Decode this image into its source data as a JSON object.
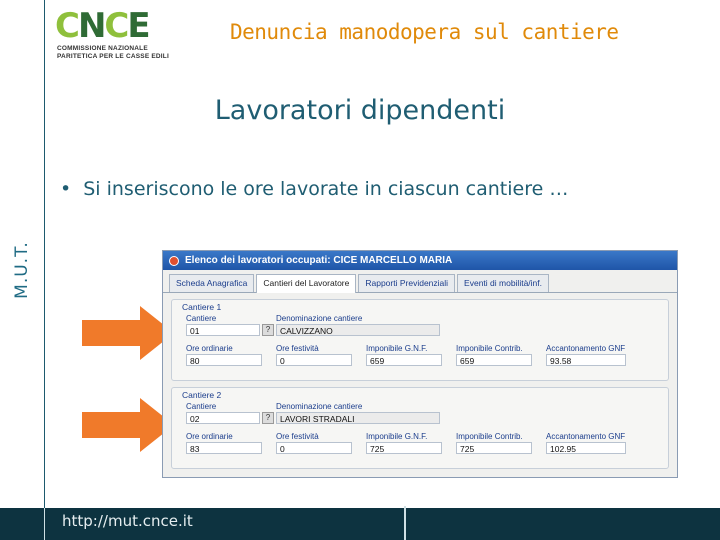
{
  "side_label": "M.U.T.",
  "logo": {
    "text_main": "CNCE",
    "sub1": "COMMISSIONE NAZIONALE",
    "sub2": "PARITETICA PER LE CASSE EDILI"
  },
  "header_title": "Denuncia manodopera sul cantiere",
  "page_title": "Lavoratori dipendenti",
  "bullet": "Si inseriscono le ore lavorate in ciascun cantiere …",
  "window": {
    "title": "Elenco dei lavoratori occupati: CICE MARCELLO MARIA",
    "tabs": [
      "Scheda Anagrafica",
      "Cantieri del Lavoratore",
      "Rapporti Previdenziali",
      "Eventi di mobilità/inf."
    ],
    "groups": [
      {
        "title": "Cantiere 1",
        "cantiere_label": "Cantiere",
        "cantiere_value": "01",
        "btn": "?",
        "denominazione_label": "Denominazione cantiere",
        "denominazione_value": "CALVIZZANO",
        "ore_ordinarie_label": "Ore ordinarie",
        "ore_ordinarie_value": "80",
        "ore_festivita_label": "Ore festività",
        "ore_festivita_value": "0",
        "imponibile_gnf_label": "Imponibile G.N.F.",
        "imponibile_gnf_value": "659",
        "imponibile_contrib_label": "Imponibile Contrib.",
        "imponibile_contrib_value": "659",
        "accantonamento_label": "Accantonamento GNF",
        "accantonamento_value": "93.58"
      },
      {
        "title": "Cantiere 2",
        "cantiere_label": "Cantiere",
        "cantiere_value": "02",
        "btn": "?",
        "denominazione_label": "Denominazione cantiere",
        "denominazione_value": "LAVORI STRADALI",
        "ore_ordinarie_label": "Ore ordinarie",
        "ore_ordinarie_value": "83",
        "ore_festivita_label": "Ore festività",
        "ore_festivita_value": "0",
        "imponibile_gnf_label": "Imponibile G.N.F.",
        "imponibile_gnf_value": "725",
        "imponibile_contrib_label": "Imponibile Contrib.",
        "imponibile_contrib_value": "725",
        "accantonamento_label": "Accantonamento GNF",
        "accantonamento_value": "102.95"
      }
    ]
  },
  "footer_url": "http://mut.cnce.it",
  "colors": {
    "accent_orange": "#e08a0a",
    "title_blue": "#1f5d72",
    "footer_bg": "#0d3340",
    "arrow_orange": "#f07a2a"
  }
}
